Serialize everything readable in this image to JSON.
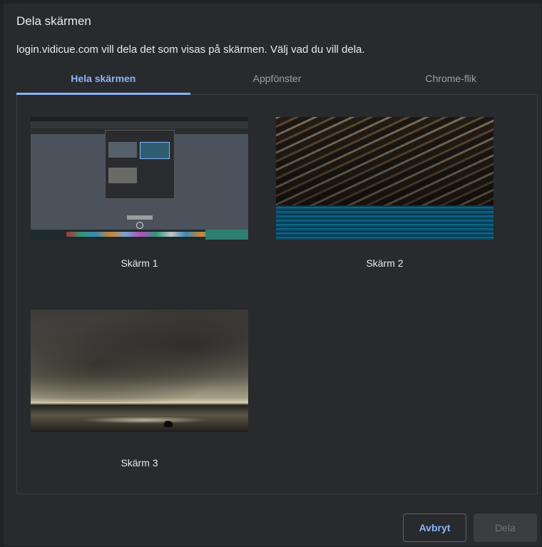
{
  "dialog": {
    "title": "Dela skärmen",
    "subtitle": "login.vidicue.com vill dela det som visas på skärmen. Välj vad du vill dela."
  },
  "tabs": [
    {
      "label": "Hela skärmen",
      "active": true
    },
    {
      "label": "Appfönster",
      "active": false
    },
    {
      "label": "Chrome-flik",
      "active": false
    }
  ],
  "screens": [
    {
      "label": "Skärm 1"
    },
    {
      "label": "Skärm 2"
    },
    {
      "label": "Skärm 3"
    }
  ],
  "buttons": {
    "cancel": "Avbryt",
    "share": "Dela"
  },
  "colors": {
    "accent": "#8ab4f8",
    "background": "#292a2d"
  }
}
